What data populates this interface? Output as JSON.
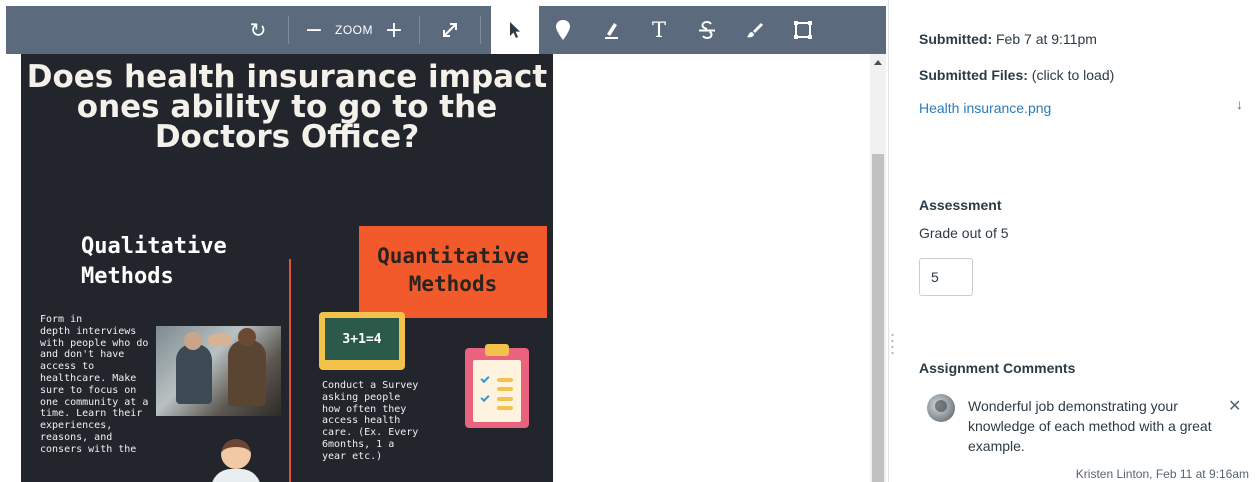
{
  "toolbar": {
    "zoom_label": "ZOOM",
    "icons": [
      "rotate-icon",
      "zoom-out-icon",
      "zoom-in-icon",
      "fullscreen-icon",
      "pointer-icon",
      "pin-icon",
      "highlight-icon",
      "text-icon",
      "strikeout-icon",
      "freedraw-icon",
      "rectangle-icon"
    ]
  },
  "poster": {
    "title": "Does health insurance impact ones ability to go to the Doctors Office?",
    "qualitative_heading": "Qualitative Methods",
    "qualitative_text": "Form in\ndepth interviews\nwith people who do\nand don't have\naccess to\nhealthcare. Make\nsure to focus on\none community at a\ntime. Learn their\nexperiences,\nreasons, and\nconsers with the",
    "quantitative_heading": "Quantitative Methods",
    "chalkboard": "3+1=4",
    "quantitative_text": "Conduct a Survey\nasking people\nhow often they\naccess health\ncare. (Ex. Every\n6months, 1 a\nyear etc.)"
  },
  "submission": {
    "submitted_label": "Submitted:",
    "submitted_value": "Feb 7 at 9:11pm",
    "files_label": "Submitted Files:",
    "files_hint": "(click to load)",
    "file_name": "Health insurance.png"
  },
  "assessment": {
    "heading": "Assessment",
    "grade_label": "Grade out of 5",
    "grade_value": "5"
  },
  "comments": {
    "heading": "Assignment Comments",
    "items": [
      {
        "text": "Wonderful job demonstrating your knowledge of each method with a great example.",
        "meta": "Kristen Linton, Feb 11 at 9:16am"
      }
    ]
  },
  "colors": {
    "toolbar_bg": "#5b6b7d",
    "link": "#2b7abc",
    "text": "#2d3b45",
    "poster_bg": "#22252b",
    "accent_orange": "#f25a2c"
  }
}
